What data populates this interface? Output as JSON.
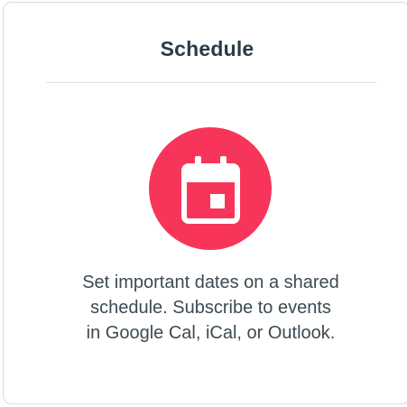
{
  "card": {
    "title": "Schedule",
    "icon": "calendar-icon",
    "description_lines": [
      "Set important dates on a shared",
      "schedule. Subscribe to events",
      "in Google Cal, iCal, or Outlook."
    ]
  },
  "colors": {
    "accent": "#f7355b",
    "title": "#283c46",
    "text": "#3d4a52"
  }
}
